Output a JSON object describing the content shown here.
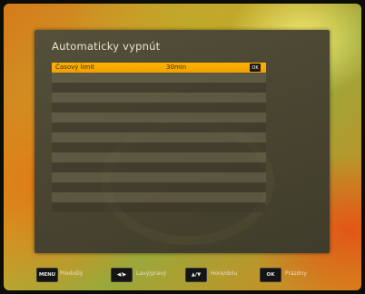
{
  "screen": {
    "title": "Automaticky vypnút"
  },
  "menu": {
    "selected_row": {
      "label": "Časový limit",
      "value": "30min",
      "ok_label": "OK"
    },
    "empty_rows": 14
  },
  "footer": {
    "keys": [
      {
        "key": "MENU",
        "label": "Predošlý"
      },
      {
        "key": "◀/▶",
        "label": "Lavý/pravý"
      },
      {
        "key": "▲/▼",
        "label": "Hore/dolu"
      },
      {
        "key": "OK",
        "label": "Prázdny"
      }
    ]
  },
  "colors": {
    "accent": "#f5a800",
    "panel": "#4a4632"
  }
}
